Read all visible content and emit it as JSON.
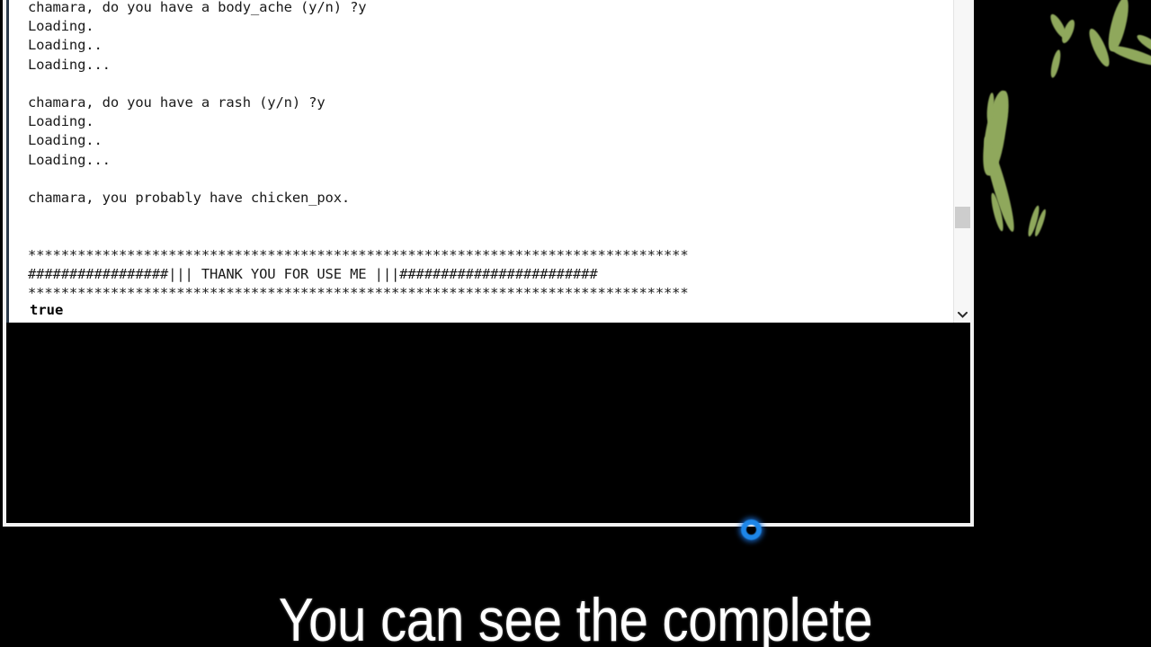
{
  "window": {
    "name": "command-prompt-console",
    "scrollbar": {
      "down_arrow_icon": "chevron-down-icon"
    }
  },
  "console": {
    "output_lines": [
      "chamara, do you have a body_ache (y/n) ?y",
      "Loading.",
      "Loading..",
      "Loading...",
      "",
      "chamara, do you have a rash (y/n) ?y",
      "Loading.",
      "Loading..",
      "Loading...",
      "",
      "chamara, you probably have chicken_pox.",
      "",
      "",
      "********************************************************************************",
      "#################||| THANK YOU FOR USE ME |||########################",
      "********************************************************************************"
    ],
    "result_value": "true"
  },
  "cursor": {
    "icon": "busy-ring-cursor",
    "color": "#1d86e8"
  },
  "subtitle": {
    "text": "You can see the complete"
  },
  "wallpaper": {
    "leaf_color": "#8fa85c",
    "background_color": "#000000"
  }
}
